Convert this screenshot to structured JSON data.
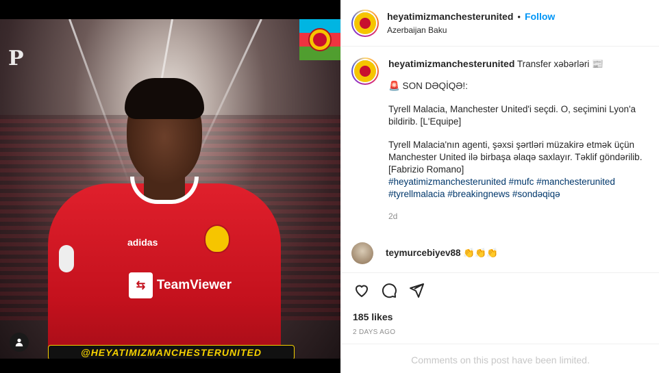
{
  "colors": {
    "accent": "#0095f6",
    "hashtag": "#00376b",
    "muted": "#8e8e8e",
    "jersey_red": "#c4111d"
  },
  "photo": {
    "sponsor_text": "TeamViewer",
    "brand_text": "adidas",
    "watermark": "@HEYATIMIZMANCHESTERUNITED",
    "logo_text": "P",
    "icons": [
      "user-tag-icon"
    ]
  },
  "header": {
    "username": "heyatimizmanchesterunited",
    "separator": "•",
    "follow_label": "Follow",
    "location": "Azerbaijan Baku"
  },
  "caption": {
    "username": "heyatimizmanchesterunited",
    "title_suffix": "Transfer xəbərləri 📰",
    "line1": "🚨 SON DƏQİQƏ!:",
    "para1": "Tyrell Malacia, Manchester United'i seçdi. O, seçimini Lyon'a bildirib. [L'Equipe]",
    "para2": "Tyrell Malacia'nın agenti, şəxsi şərtləri müzakirə etmək üçün Manchester United ilə birbaşa əlaqə saxlayır. Təklif göndərilib. [Fabrizio Romano]",
    "hashtags1": "#heyatimizmanchesterunited #mufc #manchesterunited",
    "hashtags2": "#tyrellmalacia #breakingnews #sondəqiqə",
    "time": "2d"
  },
  "comment": {
    "username": "teymurcebiyev88",
    "text": "👏👏👏"
  },
  "actions": {
    "icons": [
      "heart-icon",
      "comment-icon",
      "share-icon"
    ]
  },
  "likes": "185 likes",
  "posted": "2 DAYS AGO",
  "limited_note": "Comments on this post have been limited."
}
